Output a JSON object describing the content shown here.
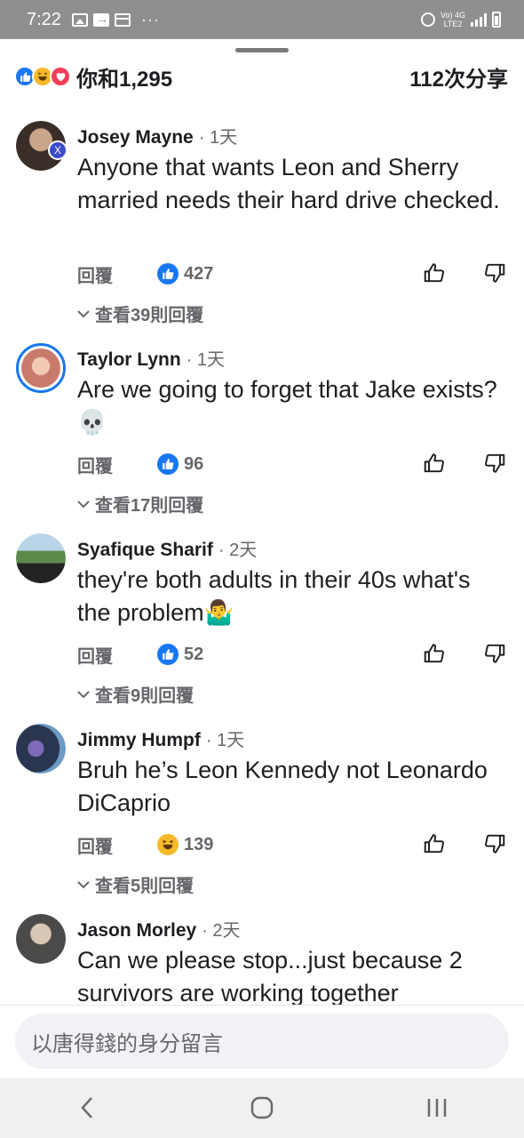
{
  "status_bar": {
    "time": "7:22",
    "dots": "···",
    "net_top": "Vo) 4G",
    "net_bottom": "LTE2"
  },
  "header": {
    "reaction_text": "你和1,295",
    "share_text": "112次分享",
    "reaction_icons": [
      "like-icon",
      "haha-icon",
      "love-icon"
    ]
  },
  "comments": [
    {
      "name": "Josey Mayne",
      "time": "· 1天",
      "text": "Anyone that wants Leon and Sherry married needs their hard drive checked.",
      "reply_label": "回覆",
      "reaction_icon": "like-icon",
      "reaction_count": "427",
      "view_replies": "查看39則回覆"
    },
    {
      "name": "Taylor Lynn",
      "time": "· 1天",
      "text": "Are we going to forget that Jake exists?💀",
      "reply_label": "回覆",
      "reaction_icon": "like-icon",
      "reaction_count": "96",
      "view_replies": "查看17則回覆"
    },
    {
      "name": "Syafique Sharif",
      "time": "· 2天",
      "text": "they're both adults in their 40s what's the problem🤷‍♂️",
      "reply_label": "回覆",
      "reaction_icon": "like-icon",
      "reaction_count": "52",
      "view_replies": "查看9則回覆"
    },
    {
      "name": "Jimmy Humpf",
      "time": "· 1天",
      "text": "Bruh he’s Leon Kennedy not Leonardo DiCaprio",
      "reply_label": "回覆",
      "reaction_icon": "haha-icon",
      "reaction_count": "139",
      "view_replies": "查看5則回覆"
    },
    {
      "name": "Jason Morley",
      "time": "· 2天",
      "text": "Can we please stop...just because 2 survivors are working together"
    }
  ],
  "input": {
    "placeholder": "以唐得錢的身分留言"
  },
  "colors": {
    "facebook_blue": "#1877f2",
    "haha_yellow": "#f7b928",
    "love_red": "#f33e58",
    "secondary_text": "#65676b"
  }
}
